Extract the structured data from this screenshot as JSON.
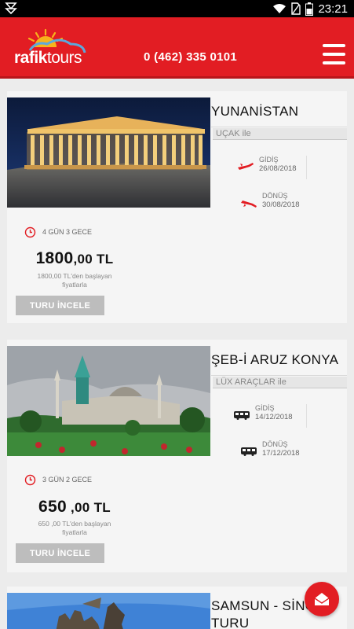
{
  "status_bar": {
    "time": "23:21",
    "icons": [
      "notification-icon",
      "wifi-icon",
      "no-sim-icon",
      "battery-icon"
    ]
  },
  "header": {
    "logo_text_bold": "rafik",
    "logo_text_light": "tours",
    "phone": "0 (462) 335 0101",
    "menu_icon": "hamburger-menu-icon",
    "colors": {
      "brand_red": "#e21d23"
    }
  },
  "tours": [
    {
      "title": "YUNANİSTAN",
      "transport": "UÇAK ile",
      "departure_label": "GİDİŞ",
      "departure_date": "26/08/2018",
      "return_label": "DÖNÜŞ",
      "return_date": "30/08/2018",
      "duration": "4 GÜN 3 GECE",
      "price_main": "1800",
      "price_cents": ",00 TL",
      "price_note_line1": "1800,00 TL'den başlayan",
      "price_note_line2": "fiyatlarla",
      "button_label": "TURU İNCELE",
      "transport_icon": "plane-icon"
    },
    {
      "title": "ŞEB-İ ARUZ KONYA",
      "transport": "LÜX ARAÇLAR ile",
      "departure_label": "GİDİŞ",
      "departure_date": "14/12/2018",
      "return_label": "DÖNÜŞ",
      "return_date": "17/12/2018",
      "duration": "3 GÜN 2 GECE",
      "price_main": "650",
      "price_cents": " ,00 TL",
      "price_note_line1": "650 ,00 TL'den başlayan",
      "price_note_line2": "fiyatlarla",
      "button_label": "TURU İNCELE",
      "transport_icon": "bus-icon"
    },
    {
      "title_line1": "SAMSUN - SİNO",
      "title_line2": "TURU"
    }
  ],
  "fab_icon": "mail-icon"
}
